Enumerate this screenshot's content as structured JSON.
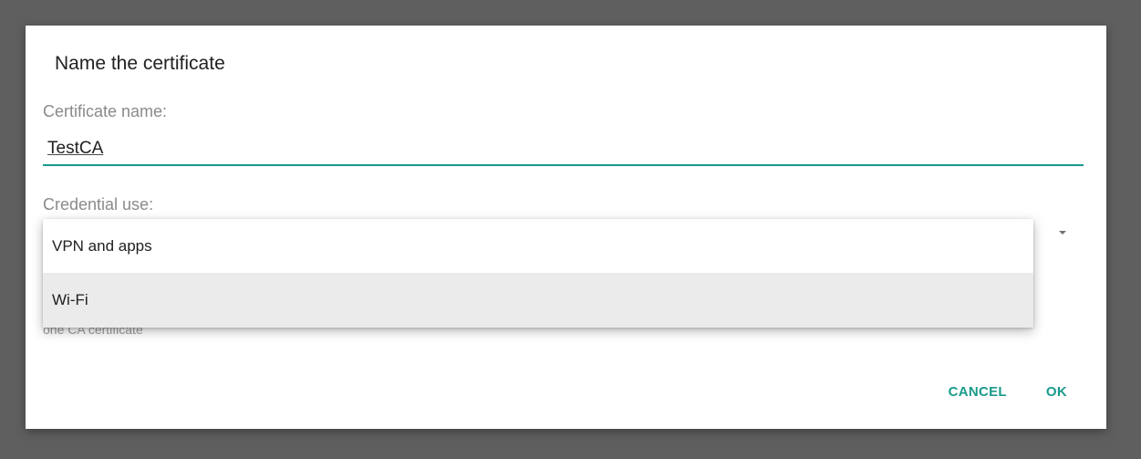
{
  "dialog": {
    "title": "Name the certificate",
    "certificate_name_label": "Certificate name:",
    "certificate_name_value": "TestCA",
    "credential_use_label": "Credential use:",
    "hint_text": "one CA certificate",
    "cancel_label": "CANCEL",
    "ok_label": "OK"
  },
  "dropdown": {
    "options": [
      {
        "label": "VPN and apps"
      },
      {
        "label": "Wi-Fi"
      }
    ]
  },
  "colors": {
    "accent": "#199a8b",
    "scrim": "#5f5f5f",
    "dialog_background": "#ffffff",
    "highlight": "#ebebeb"
  }
}
